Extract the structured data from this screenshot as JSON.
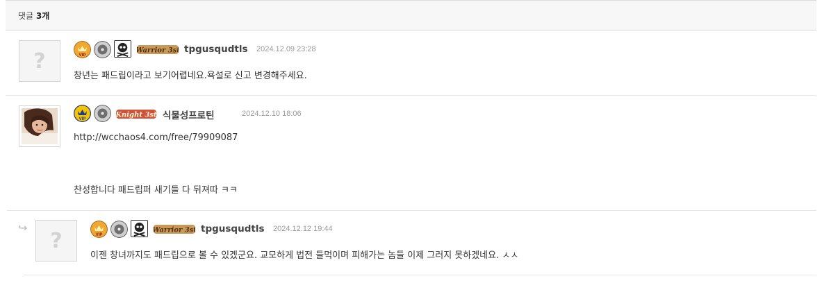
{
  "header": {
    "label": "댓글",
    "count": "3개"
  },
  "comments": [
    {
      "nickname": "tpgusqudtls",
      "date": "2024.12.09 23:28",
      "avatar": "question-mark-placeholder",
      "badges": [
        "vip-badge-icon",
        "disc-badge-icon",
        "skull-badge-icon"
      ],
      "rank_label": "Warrior 3st",
      "text": "창년는 패드립이라고 보기어렵네요.욕설로 신고 변경해주세요."
    },
    {
      "nickname": "식물성프로틴",
      "date": "2024.12.10 18:06",
      "avatar": "user-photo",
      "badges": [
        "vip-badge-icon",
        "disc-badge-icon"
      ],
      "rank_label": "Knight 3st",
      "link": "http://wcchaos4.com/free/79909087",
      "text": "찬성합니다 패드립퍼 새기들 다 뒤져따 ㅋㅋ"
    },
    {
      "nickname": "tpgusqudtls",
      "date": "2024.12.12 19:44",
      "avatar": "question-mark-placeholder",
      "badges": [
        "vip-badge-icon",
        "disc-badge-icon",
        "skull-badge-icon"
      ],
      "rank_label": "Warrior 3st",
      "text": "이젠 창녀까지도 패드립으로 볼 수 있겠군요. 교모하게 법전 들먹이며 피해가는 놈들 이제 그러지 못하겠네요. ㅅㅅ",
      "is_reply": true
    }
  ],
  "colors": {
    "header_bg": "#f7f7f7",
    "border": "#dcdcdc",
    "date": "#999999",
    "rank_bronze": "#8a5a2b",
    "rank_red": "#b52a1e"
  }
}
